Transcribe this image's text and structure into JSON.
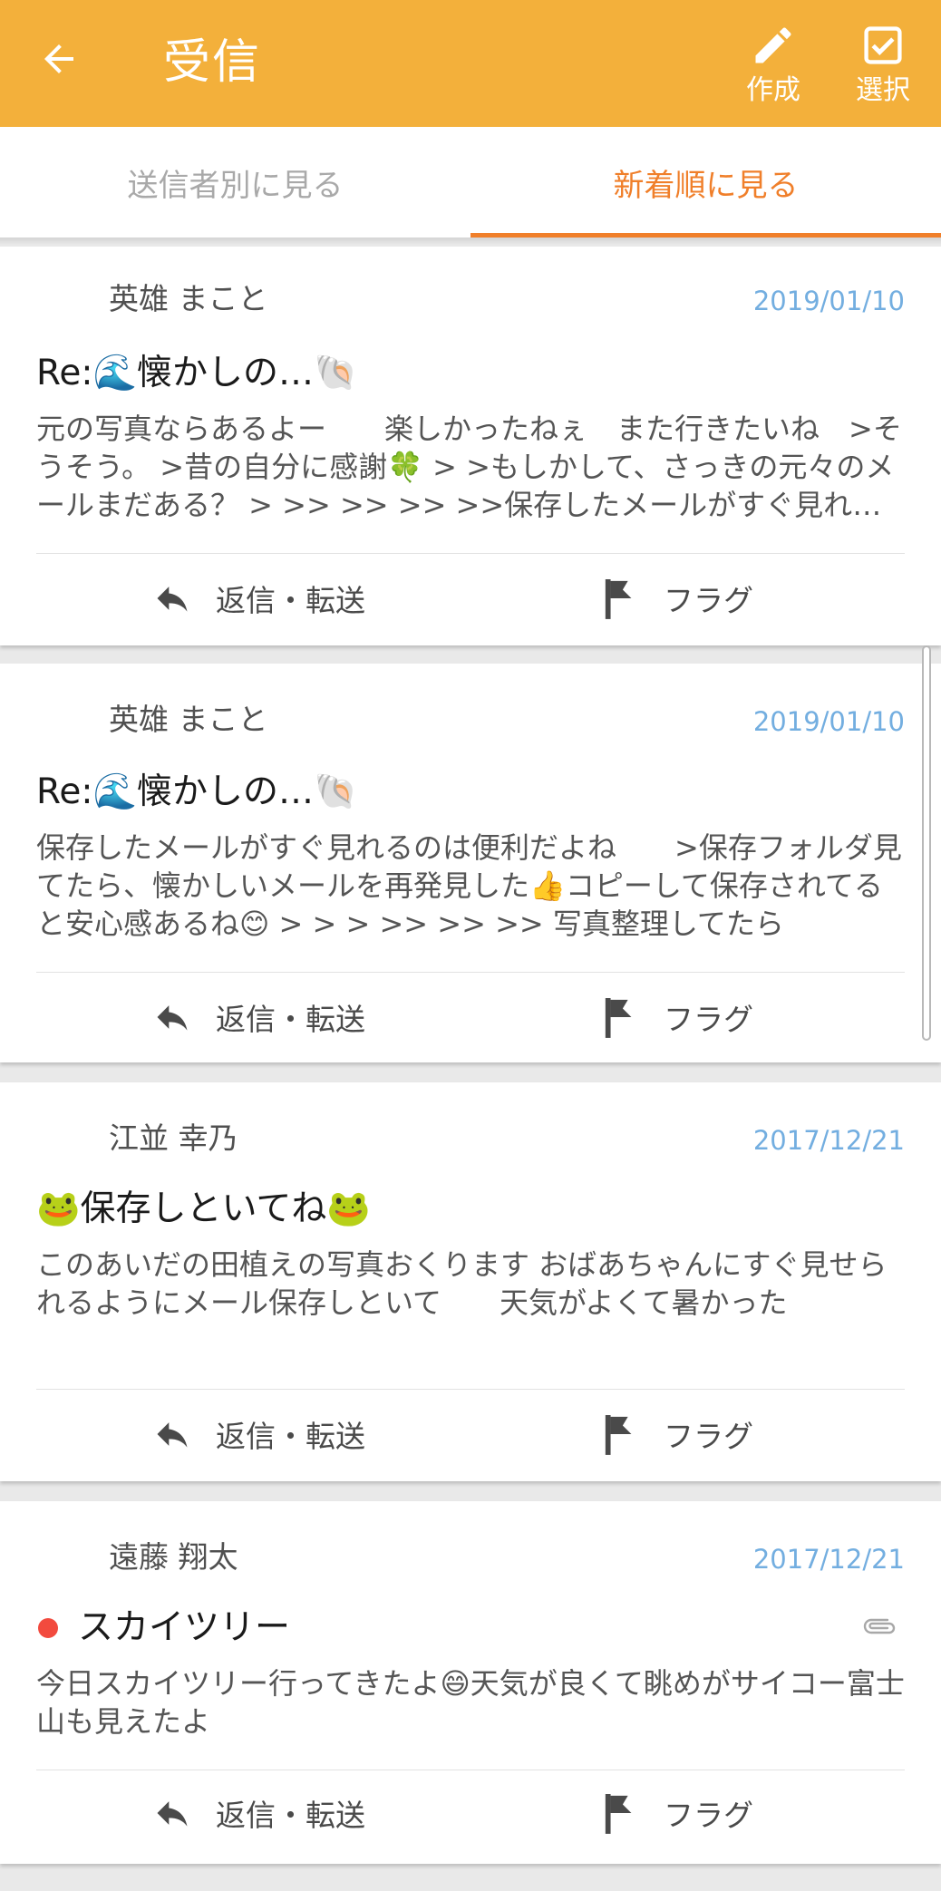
{
  "appbar": {
    "title": "受信",
    "compose_label": "作成",
    "select_label": "選択"
  },
  "tabs": {
    "by_sender": "送信者別に見る",
    "newest": "新着順に見る",
    "active": "newest"
  },
  "actions": {
    "reply_label": "返信・転送",
    "flag_label": "フラグ"
  },
  "messages": [
    {
      "sender": "英雄 まこと",
      "date": "2019/01/10",
      "subject": "Re:🌊懐かしの…🐚",
      "preview": "元の写真ならあるよー　　楽しかったねぇ　また行きたいね　>そうそう。 >昔の自分に感謝🍀 > >もしかして、さっきの元々のメールまだある？ > >> >> >> >>保存したメールがすぐ見れるのは便利だよね",
      "unread": false,
      "attachment": false
    },
    {
      "sender": "英雄 まこと",
      "date": "2019/01/10",
      "subject": "Re:🌊懐かしの…🐚",
      "preview": "保存したメールがすぐ見れるのは便利だよね　　>保存フォルダ見てたら、懐かしいメールを再発見した👍コピーして保存されてると安心感あるね😊 > > > >> >> >> 写真整理してたら",
      "unread": false,
      "attachment": false
    },
    {
      "sender": "江並 幸乃",
      "date": "2017/12/21",
      "subject": "🐸保存しといてね🐸",
      "preview": "このあいだの田植えの写真おくります おばあちゃんにすぐ見せられるようにメール保存しといて　　天気がよくて暑かった",
      "unread": false,
      "attachment": false
    },
    {
      "sender": "遠藤 翔太",
      "date": "2017/12/21",
      "subject": "スカイツリー",
      "preview": "今日スカイツリー行ってきたよ😄天気が良くて眺めがサイコー富士山も見えたよ",
      "unread": true,
      "attachment": true
    }
  ],
  "colors": {
    "appbar": "#f3b03b",
    "tab_active": "#f07f2a",
    "tab_inactive": "#a9a9a9",
    "date": "#73aee0",
    "unread_dot": "#f24a3e"
  },
  "icons": [
    "back-arrow-icon",
    "pencil-icon",
    "checkbox-icon",
    "reply-icon",
    "flag-icon",
    "paperclip-icon"
  ]
}
